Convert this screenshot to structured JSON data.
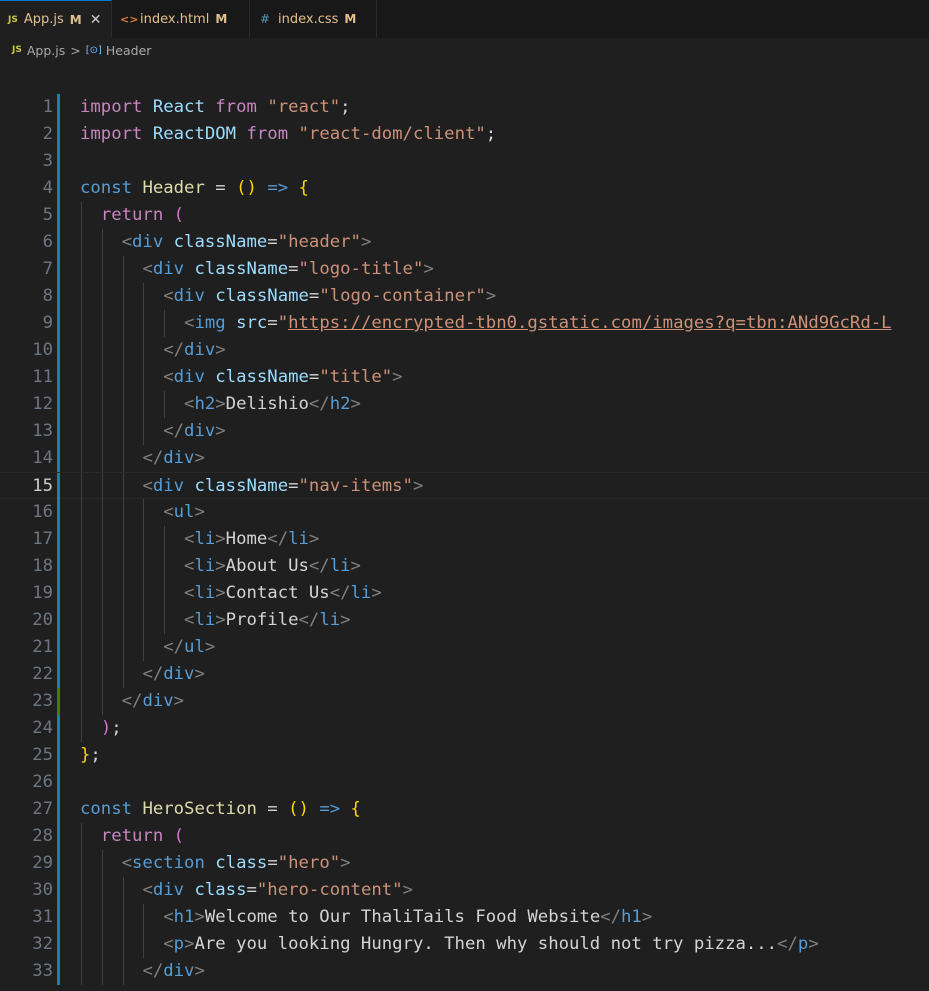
{
  "tabs": [
    {
      "icon": "JS",
      "label": "App.js",
      "status": "M",
      "active": true,
      "close": "✕"
    },
    {
      "icon": "<>",
      "label": "index.html",
      "status": "M",
      "active": false
    },
    {
      "icon": "#",
      "label": "index.css",
      "status": "M",
      "active": false
    }
  ],
  "breadcrumb": {
    "file_icon": "JS",
    "file": "App.js",
    "separator": ">",
    "symbol_icon": "[⊙]",
    "symbol": "Header"
  },
  "editor": {
    "current_line": 15,
    "lines": [
      {
        "n": 1,
        "tokens": [
          [
            "kwc",
            "import"
          ],
          [
            "txt",
            " "
          ],
          [
            "id",
            "React"
          ],
          [
            "txt",
            " "
          ],
          [
            "kwc",
            "from"
          ],
          [
            "txt",
            " "
          ],
          [
            "str",
            "\"react\""
          ],
          [
            "txt",
            ";"
          ]
        ]
      },
      {
        "n": 2,
        "tokens": [
          [
            "kwc",
            "import"
          ],
          [
            "txt",
            " "
          ],
          [
            "id",
            "ReactDOM"
          ],
          [
            "txt",
            " "
          ],
          [
            "kwc",
            "from"
          ],
          [
            "txt",
            " "
          ],
          [
            "str",
            "\"react-dom/client\""
          ],
          [
            "txt",
            ";"
          ]
        ]
      },
      {
        "n": 3,
        "tokens": []
      },
      {
        "n": 4,
        "tokens": [
          [
            "kw",
            "const"
          ],
          [
            "txt",
            " "
          ],
          [
            "fn",
            "Header"
          ],
          [
            "txt",
            " = "
          ],
          [
            "b1",
            "()"
          ],
          [
            "txt",
            " "
          ],
          [
            "kw",
            "=>"
          ],
          [
            "txt",
            " "
          ],
          [
            "b1",
            "{"
          ]
        ]
      },
      {
        "n": 5,
        "tokens": [
          [
            "txt",
            "  "
          ],
          [
            "kwc",
            "return"
          ],
          [
            "txt",
            " "
          ],
          [
            "b2",
            "("
          ]
        ]
      },
      {
        "n": 6,
        "tokens": [
          [
            "txt",
            "    "
          ],
          [
            "br",
            "<"
          ],
          [
            "tag",
            "div"
          ],
          [
            "txt",
            " "
          ],
          [
            "attr",
            "className"
          ],
          [
            "txt",
            "="
          ],
          [
            "str",
            "\"header\""
          ],
          [
            "br",
            ">"
          ]
        ]
      },
      {
        "n": 7,
        "tokens": [
          [
            "txt",
            "      "
          ],
          [
            "br",
            "<"
          ],
          [
            "tag",
            "div"
          ],
          [
            "txt",
            " "
          ],
          [
            "attr",
            "className"
          ],
          [
            "txt",
            "="
          ],
          [
            "str",
            "\"logo-title\""
          ],
          [
            "br",
            ">"
          ]
        ]
      },
      {
        "n": 8,
        "tokens": [
          [
            "txt",
            "        "
          ],
          [
            "br",
            "<"
          ],
          [
            "tag",
            "div"
          ],
          [
            "txt",
            " "
          ],
          [
            "attr",
            "className"
          ],
          [
            "txt",
            "="
          ],
          [
            "str",
            "\"logo-container\""
          ],
          [
            "br",
            ">"
          ]
        ]
      },
      {
        "n": 9,
        "tokens": [
          [
            "txt",
            "          "
          ],
          [
            "br",
            "<"
          ],
          [
            "tag",
            "img"
          ],
          [
            "txt",
            " "
          ],
          [
            "attr",
            "src"
          ],
          [
            "txt",
            "="
          ],
          [
            "str",
            "\""
          ],
          [
            "url",
            "https://encrypted-tbn0.gstatic.com/images?q=tbn:ANd9GcRd-L"
          ]
        ]
      },
      {
        "n": 10,
        "tokens": [
          [
            "txt",
            "        "
          ],
          [
            "br",
            "</"
          ],
          [
            "tag",
            "div"
          ],
          [
            "br",
            ">"
          ]
        ]
      },
      {
        "n": 11,
        "tokens": [
          [
            "txt",
            "        "
          ],
          [
            "br",
            "<"
          ],
          [
            "tag",
            "div"
          ],
          [
            "txt",
            " "
          ],
          [
            "attr",
            "className"
          ],
          [
            "txt",
            "="
          ],
          [
            "str",
            "\"title\""
          ],
          [
            "br",
            ">"
          ]
        ]
      },
      {
        "n": 12,
        "tokens": [
          [
            "txt",
            "          "
          ],
          [
            "br",
            "<"
          ],
          [
            "tag",
            "h2"
          ],
          [
            "br",
            ">"
          ],
          [
            "txt",
            "Delishio"
          ],
          [
            "br",
            "</"
          ],
          [
            "tag",
            "h2"
          ],
          [
            "br",
            ">"
          ]
        ]
      },
      {
        "n": 13,
        "tokens": [
          [
            "txt",
            "        "
          ],
          [
            "br",
            "</"
          ],
          [
            "tag",
            "div"
          ],
          [
            "br",
            ">"
          ]
        ]
      },
      {
        "n": 14,
        "tokens": [
          [
            "txt",
            "      "
          ],
          [
            "br",
            "</"
          ],
          [
            "tag",
            "div"
          ],
          [
            "br",
            ">"
          ]
        ]
      },
      {
        "n": 15,
        "tokens": [
          [
            "txt",
            "      "
          ],
          [
            "br",
            "<"
          ],
          [
            "tag",
            "div"
          ],
          [
            "txt",
            " "
          ],
          [
            "attr",
            "className"
          ],
          [
            "txt",
            "="
          ],
          [
            "str",
            "\"nav-items\""
          ],
          [
            "br",
            ">"
          ]
        ]
      },
      {
        "n": 16,
        "tokens": [
          [
            "txt",
            "        "
          ],
          [
            "br",
            "<"
          ],
          [
            "tag",
            "ul"
          ],
          [
            "br",
            ">"
          ]
        ]
      },
      {
        "n": 17,
        "tokens": [
          [
            "txt",
            "          "
          ],
          [
            "br",
            "<"
          ],
          [
            "tag",
            "li"
          ],
          [
            "br",
            ">"
          ],
          [
            "txt",
            "Home"
          ],
          [
            "br",
            "</"
          ],
          [
            "tag",
            "li"
          ],
          [
            "br",
            ">"
          ]
        ]
      },
      {
        "n": 18,
        "tokens": [
          [
            "txt",
            "          "
          ],
          [
            "br",
            "<"
          ],
          [
            "tag",
            "li"
          ],
          [
            "br",
            ">"
          ],
          [
            "txt",
            "About Us"
          ],
          [
            "br",
            "</"
          ],
          [
            "tag",
            "li"
          ],
          [
            "br",
            ">"
          ]
        ]
      },
      {
        "n": 19,
        "tokens": [
          [
            "txt",
            "          "
          ],
          [
            "br",
            "<"
          ],
          [
            "tag",
            "li"
          ],
          [
            "br",
            ">"
          ],
          [
            "txt",
            "Contact Us"
          ],
          [
            "br",
            "</"
          ],
          [
            "tag",
            "li"
          ],
          [
            "br",
            ">"
          ]
        ]
      },
      {
        "n": 20,
        "tokens": [
          [
            "txt",
            "          "
          ],
          [
            "br",
            "<"
          ],
          [
            "tag",
            "li"
          ],
          [
            "br",
            ">"
          ],
          [
            "txt",
            "Profile"
          ],
          [
            "br",
            "</"
          ],
          [
            "tag",
            "li"
          ],
          [
            "br",
            ">"
          ]
        ]
      },
      {
        "n": 21,
        "tokens": [
          [
            "txt",
            "        "
          ],
          [
            "br",
            "</"
          ],
          [
            "tag",
            "ul"
          ],
          [
            "br",
            ">"
          ]
        ]
      },
      {
        "n": 22,
        "tokens": [
          [
            "txt",
            "      "
          ],
          [
            "br",
            "</"
          ],
          [
            "tag",
            "div"
          ],
          [
            "br",
            ">"
          ]
        ]
      },
      {
        "n": 23,
        "tokens": [
          [
            "txt",
            "    "
          ],
          [
            "br",
            "</"
          ],
          [
            "tag",
            "div"
          ],
          [
            "br",
            ">"
          ]
        ]
      },
      {
        "n": 24,
        "tokens": [
          [
            "txt",
            "  "
          ],
          [
            "b2",
            ")"
          ],
          [
            "txt",
            ";"
          ]
        ]
      },
      {
        "n": 25,
        "tokens": [
          [
            "b1",
            "}"
          ],
          [
            "txt",
            ";"
          ]
        ]
      },
      {
        "n": 26,
        "tokens": []
      },
      {
        "n": 27,
        "tokens": [
          [
            "kw",
            "const"
          ],
          [
            "txt",
            " "
          ],
          [
            "fn",
            "HeroSection"
          ],
          [
            "txt",
            " = "
          ],
          [
            "b1",
            "()"
          ],
          [
            "txt",
            " "
          ],
          [
            "kw",
            "=>"
          ],
          [
            "txt",
            " "
          ],
          [
            "b1",
            "{"
          ]
        ]
      },
      {
        "n": 28,
        "tokens": [
          [
            "txt",
            "  "
          ],
          [
            "kwc",
            "return"
          ],
          [
            "txt",
            " "
          ],
          [
            "b2",
            "("
          ]
        ]
      },
      {
        "n": 29,
        "tokens": [
          [
            "txt",
            "    "
          ],
          [
            "br",
            "<"
          ],
          [
            "tag",
            "section"
          ],
          [
            "txt",
            " "
          ],
          [
            "attr",
            "class"
          ],
          [
            "txt",
            "="
          ],
          [
            "str",
            "\"hero\""
          ],
          [
            "br",
            ">"
          ]
        ]
      },
      {
        "n": 30,
        "tokens": [
          [
            "txt",
            "      "
          ],
          [
            "br",
            "<"
          ],
          [
            "tag",
            "div"
          ],
          [
            "txt",
            " "
          ],
          [
            "attr",
            "class"
          ],
          [
            "txt",
            "="
          ],
          [
            "str",
            "\"hero-content\""
          ],
          [
            "br",
            ">"
          ]
        ]
      },
      {
        "n": 31,
        "tokens": [
          [
            "txt",
            "        "
          ],
          [
            "br",
            "<"
          ],
          [
            "tag",
            "h1"
          ],
          [
            "br",
            ">"
          ],
          [
            "txt",
            "Welcome to Our ThaliTails Food Website"
          ],
          [
            "br",
            "</"
          ],
          [
            "tag",
            "h1"
          ],
          [
            "br",
            ">"
          ]
        ]
      },
      {
        "n": 32,
        "tokens": [
          [
            "txt",
            "        "
          ],
          [
            "br",
            "<"
          ],
          [
            "tag",
            "p"
          ],
          [
            "br",
            ">"
          ],
          [
            "txt",
            "Are you looking Hungry. Then why should not try pizza..."
          ],
          [
            "br",
            "</"
          ],
          [
            "tag",
            "p"
          ],
          [
            "br",
            ">"
          ]
        ]
      },
      {
        "n": 33,
        "tokens": [
          [
            "txt",
            "      "
          ],
          [
            "br",
            "</"
          ],
          [
            "tag",
            "div"
          ],
          [
            "br",
            ">"
          ]
        ]
      }
    ]
  }
}
